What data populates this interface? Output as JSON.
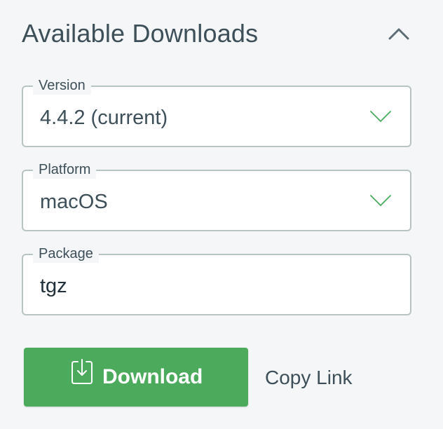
{
  "header": {
    "title": "Available Downloads",
    "collapse_icon": "chevron-up-icon"
  },
  "fields": {
    "version": {
      "label": "Version",
      "value": "4.4.2 (current)",
      "icon": "chevron-down-icon"
    },
    "platform": {
      "label": "Platform",
      "value": "macOS",
      "icon": "chevron-down-icon"
    },
    "package": {
      "label": "Package",
      "value": "tgz"
    }
  },
  "actions": {
    "download_label": "Download",
    "download_icon": "download-icon",
    "copy_link_label": "Copy Link"
  },
  "colors": {
    "background": "#f5f6f7",
    "text": "#3d4f58",
    "border": "#b8c4c2",
    "chevron_accent": "#4caa5d",
    "download_button": "#4caa5d",
    "download_text": "#ffffff"
  }
}
